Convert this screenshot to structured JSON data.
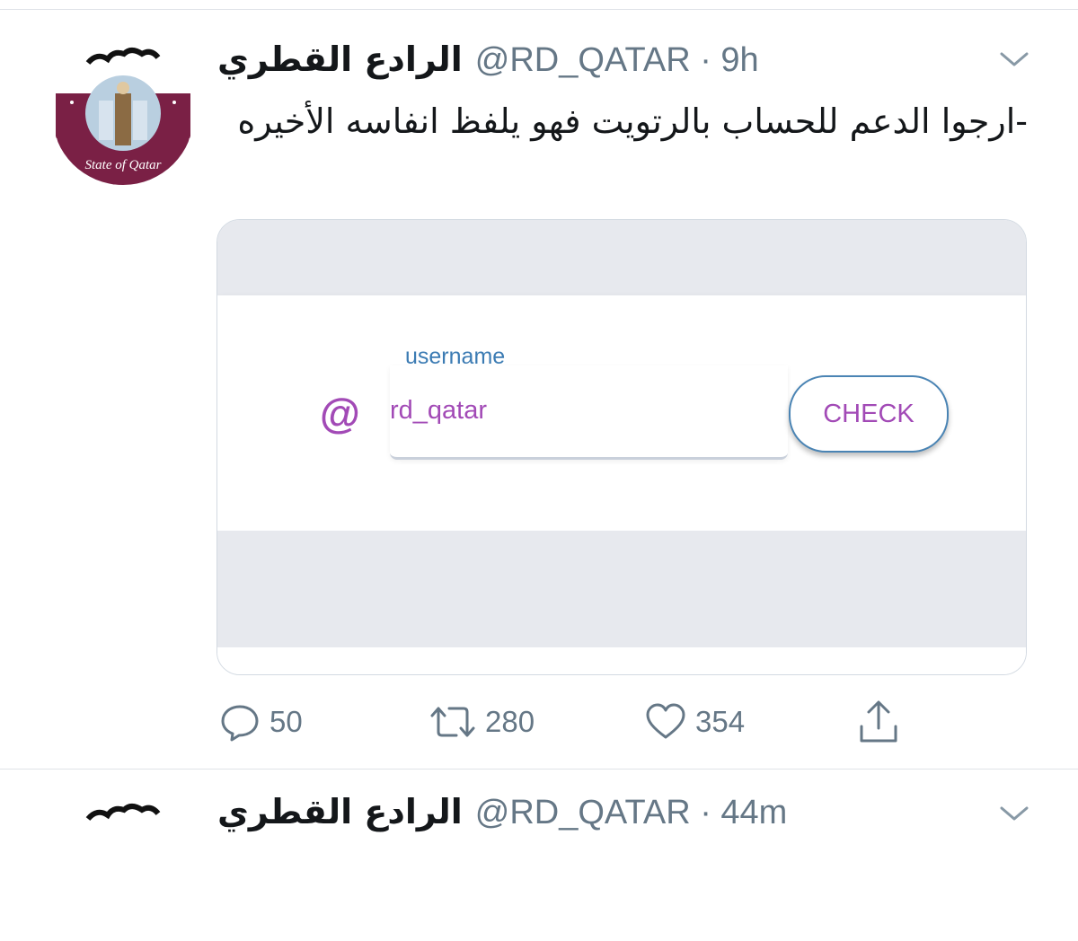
{
  "tweet": {
    "display_name": "الرادع القطري",
    "handle_line": "@RD_QATAR · 9h",
    "text": "-ارجوا الدعم للحساب بالرتويت فهو يلفظ انفاسه الأخيره",
    "avatar_caption": "State of Qatar",
    "card": {
      "field_label": "username",
      "input_value": "rd_qatar",
      "at_symbol": "@",
      "button_label": "CHECK"
    },
    "actions": {
      "replies": "50",
      "retweets": "280",
      "likes": "354"
    }
  },
  "next_tweet": {
    "display_name": "الرادع القطري",
    "handle_line": "@RD_QATAR · 44m"
  },
  "colors": {
    "accent_purple": "#a24ab6",
    "label_blue": "#3b7bb3",
    "muted_gray": "#657786",
    "maroon": "#7a2045"
  },
  "icons": [
    "chevron-down-icon",
    "reply-icon",
    "retweet-icon",
    "like-icon",
    "share-icon",
    "at-icon"
  ]
}
